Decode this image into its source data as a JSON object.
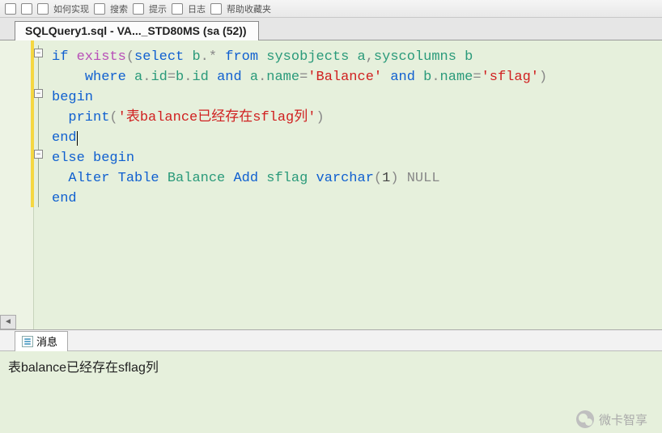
{
  "toolbar": {
    "items": [
      "如何实现",
      "搜索",
      "提示",
      "日志",
      "帮助收藏夹"
    ]
  },
  "tab": {
    "title": "SQLQuery1.sql - VA..._STD80MS (sa (52))"
  },
  "code": {
    "l1": {
      "kw1": "if",
      "fn": "exists",
      "op1": "(",
      "kw2": "select",
      "col": "b",
      "op2": ".*",
      "kw3": "from",
      "t1": "sysobjects",
      "a1": "a",
      "c": ",",
      "t2": "syscolumns",
      "a2": "b"
    },
    "l2": {
      "kw": "where",
      "e1": "a",
      "d1": ".",
      "f1": "id",
      "eq1": "=",
      "e2": "b",
      "d2": ".",
      "f2": "id",
      "and1": "and",
      "e3": "a",
      "d3": ".",
      "f3": "name",
      "eq2": "=",
      "s1": "'Balance'",
      "and2": "and",
      "e4": "b",
      "d4": ".",
      "f4": "name",
      "eq3": "=",
      "s2": "'sflag'",
      "cp": ")"
    },
    "l3": {
      "kw": "begin"
    },
    "l4": {
      "kw": "print",
      "op": "(",
      "s": "'表balance已经存在sflag列'",
      "cp": ")"
    },
    "l5": {
      "kw": "end"
    },
    "l6": {
      "kw1": "else",
      "kw2": "begin"
    },
    "l7": {
      "kw1": "Alter",
      "kw2": "Table",
      "t": "Balance",
      "kw3": "Add",
      "col": "sflag",
      "ty": "varchar",
      "op": "(",
      "n": "1",
      "cp": ")",
      "nl": "NULL"
    },
    "l8": {
      "kw": "end"
    }
  },
  "messages": {
    "tab_label": "消息",
    "line1": "表balance已经存在sflag列"
  },
  "watermark": "微卡智享",
  "scroll_arrow": "◄"
}
